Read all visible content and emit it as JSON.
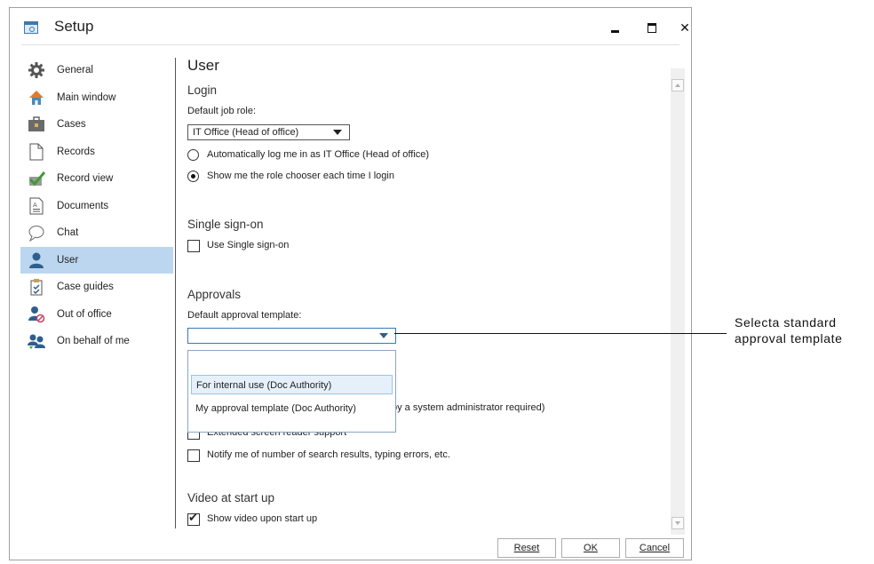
{
  "window": {
    "title": "Setup"
  },
  "sidebar": {
    "items": [
      {
        "label": "General",
        "icon": "gear-icon"
      },
      {
        "label": "Main window",
        "icon": "house-icon"
      },
      {
        "label": "Cases",
        "icon": "briefcase-icon"
      },
      {
        "label": "Records",
        "icon": "document-icon"
      },
      {
        "label": "Record view",
        "icon": "checkmark-doc-icon"
      },
      {
        "label": "Documents",
        "icon": "text-document-icon"
      },
      {
        "label": "Chat",
        "icon": "speech-bubble-icon"
      },
      {
        "label": "User",
        "icon": "user-icon",
        "active": true
      },
      {
        "label": "Case guides",
        "icon": "clipboard-icon"
      },
      {
        "label": "Out of office",
        "icon": "user-blocked-icon"
      },
      {
        "label": "On behalf of me",
        "icon": "users-icon"
      }
    ]
  },
  "main": {
    "title": "User",
    "login": {
      "heading": "Login",
      "default_job_role_label": "Default job role:",
      "default_job_role_value": "IT Office (Head of office)",
      "radio_auto": "Automatically log me in as IT Office (Head of office)",
      "radio_chooser": "Show me the role chooser each time I login",
      "selected": "chooser"
    },
    "sso": {
      "heading": "Single sign-on",
      "checkbox": "Use Single sign-on",
      "checked": false
    },
    "approvals": {
      "heading": "Approvals",
      "template_label": "Default approval template:",
      "template_value": "",
      "options": [
        "",
        "For internal use (Doc Authority)",
        "My approval template  (Doc Authority)"
      ],
      "highlighted": "For internal use (Doc Authority)"
    },
    "accessibility": {
      "partial_text": "by a system administrator required)",
      "screen_reader": "Extended screen reader support",
      "notify": "Notify me of number of search results, typing errors, etc."
    },
    "video": {
      "heading": "Video at start up",
      "checkbox": "Show video upon start up",
      "checked": true
    }
  },
  "footer": {
    "reset": "Reset",
    "ok": "OK",
    "cancel": "Cancel"
  },
  "callout": {
    "text": "Selecta standard approval template"
  }
}
